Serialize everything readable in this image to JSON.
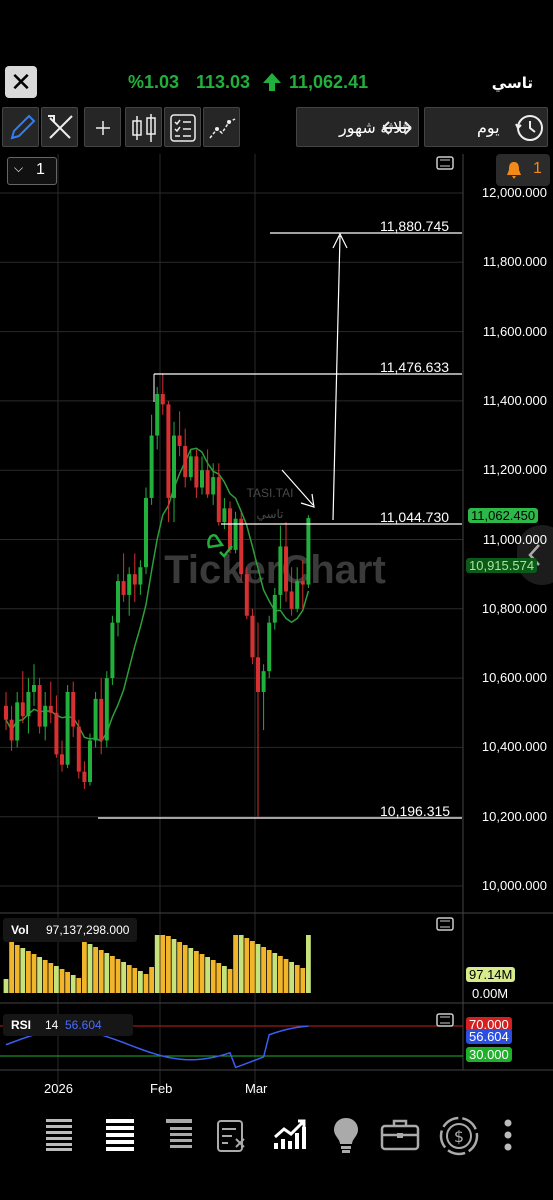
{
  "header": {
    "title": "تاسي",
    "last_price": "11,062.41",
    "change": "113.03",
    "change_percent": "%1.03",
    "close_icon": "close-icon",
    "up_arrow_icon": "up-arrow-icon"
  },
  "toolbar": {
    "period_label": "ثلاثة شهور",
    "interval_label": "يوم",
    "icons": [
      "pencil-icon",
      "tools-icon",
      "crosshair-icon",
      "candlestick-icon",
      "checklist-icon",
      "line-chart-icon",
      "swap-arrows-icon",
      "history-icon"
    ]
  },
  "chart": {
    "pane_count_label": "1",
    "alerts_count": "1",
    "symbol_watermark": "TASI.TAI",
    "watermark_sub": "تاسي",
    "brand_watermark": "TickerChart",
    "price_axis": [
      "12,000.000",
      "11,800.000",
      "11,600.000",
      "11,400.000",
      "11,200.000",
      "11,000.000",
      "10,800.000",
      "10,600.000",
      "10,400.000",
      "10,200.000",
      "10,000.000"
    ],
    "current_price_badge": "11,062.450",
    "ma_badge": "10,915.574",
    "levels": [
      "11,880.745",
      "11,476.633",
      "11,044.730",
      "10,196.315"
    ],
    "x_axis": [
      "2026",
      "Feb",
      "Mar"
    ]
  },
  "volume": {
    "label": "Vol",
    "value": "97,137,298.000",
    "axis_top": "97.14M",
    "axis_bottom": "0.00M"
  },
  "rsi": {
    "label": "RSI",
    "period": "14",
    "value": "56.604",
    "upper": "70.000",
    "lower": "30.000"
  },
  "colors": {
    "up": "#22b03c",
    "down": "#d63030",
    "ma": "#2e9e3a",
    "vol_up": "#f0b52a",
    "vol_down": "#c6e27a",
    "rsi_line": "#3a5ef0"
  },
  "bottom_nav": [
    "list-icon",
    "watchlist-icon",
    "orders-icon",
    "portfolio-icon",
    "chart-icon",
    "idea-icon",
    "briefcase-icon",
    "money-icon",
    "more-icon"
  ]
}
